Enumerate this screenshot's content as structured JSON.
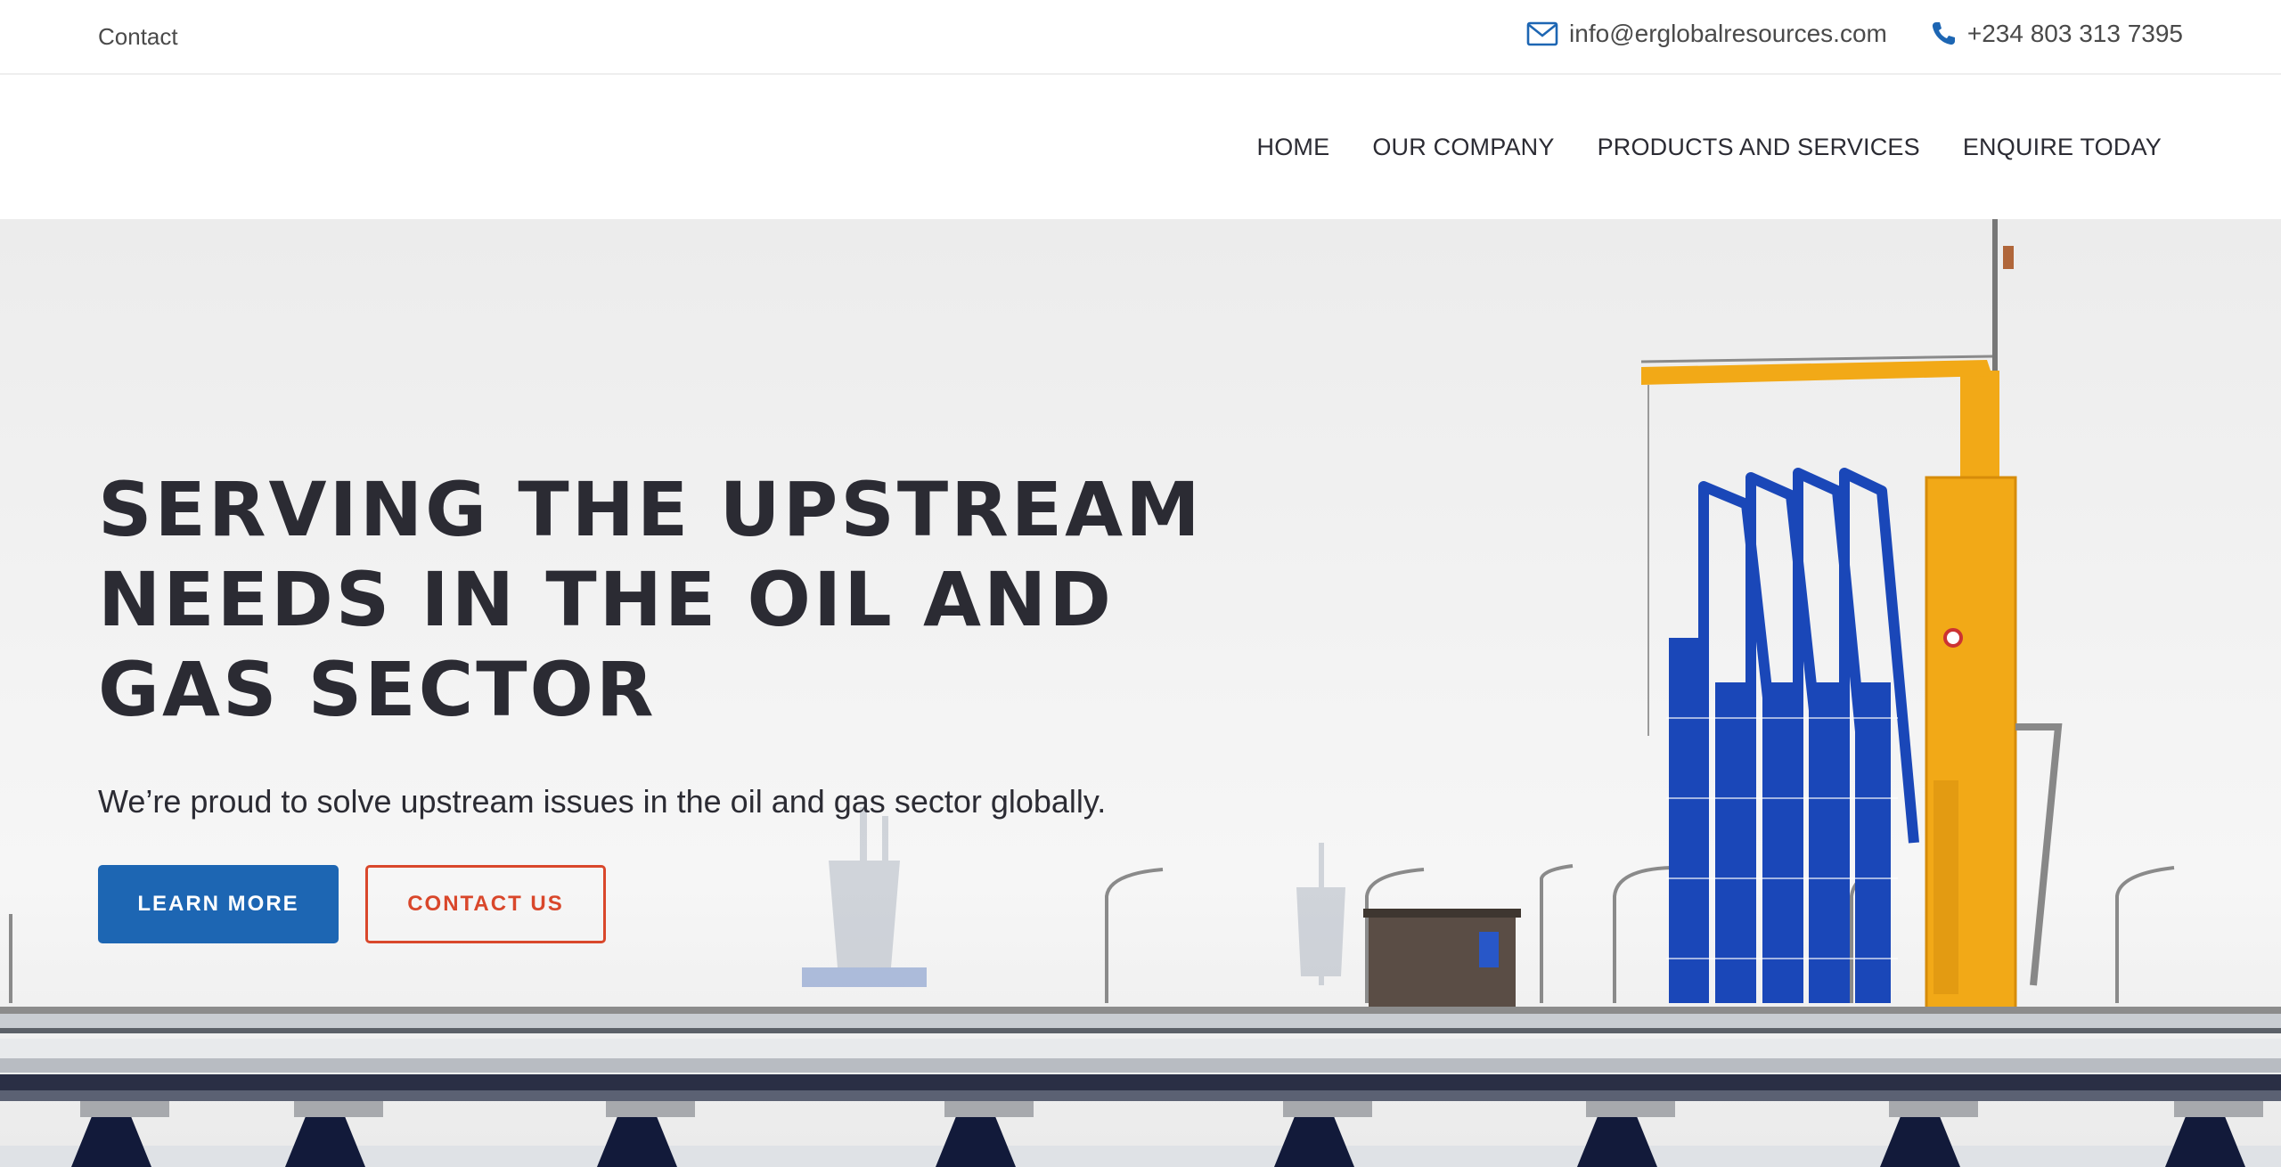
{
  "topbar": {
    "contact_label": "Contact",
    "email": "info@erglobalresources.com",
    "phone": "+234 803 313 7395",
    "icon_color": "#1d66b3"
  },
  "nav": {
    "items": [
      "HOME",
      "OUR COMPANY",
      "PRODUCTS AND SERVICES",
      "ENQUIRE TODAY"
    ]
  },
  "hero": {
    "title": "SERVING THE UPSTREAM NEEDS IN THE OIL AND GAS SECTOR",
    "subtitle": "We’re proud to solve upstream issues in the oil and gas sector globally.",
    "primary_button": "LEARN MORE",
    "secondary_button": "CONTACT US",
    "colors": {
      "primary": "#1d66b3",
      "accent": "#d9472b",
      "crane": "#f2a917",
      "loading_arms": "#1a47b8"
    }
  }
}
